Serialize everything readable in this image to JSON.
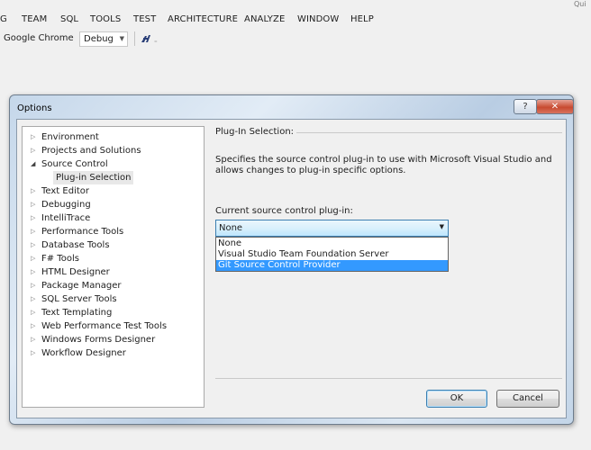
{
  "menubar": {
    "items": [
      "G",
      "TEAM",
      "SQL",
      "TOOLS",
      "TEST",
      "ARCHITECTURE",
      "ANALYZE",
      "WINDOW",
      "HELP"
    ],
    "quick_launch": "Qui"
  },
  "toolbar": {
    "browser": "Google Chrome",
    "config": "Debug"
  },
  "dialog": {
    "title": "Options",
    "help_symbol": "?",
    "close_symbol": "✕",
    "tree": [
      {
        "label": "Environment"
      },
      {
        "label": "Projects and Solutions"
      },
      {
        "label": "Source Control"
      },
      {
        "label": "Plug-in Selection"
      },
      {
        "label": "Text Editor"
      },
      {
        "label": "Debugging"
      },
      {
        "label": "IntelliTrace"
      },
      {
        "label": "Performance Tools"
      },
      {
        "label": "Database Tools"
      },
      {
        "label": "F# Tools"
      },
      {
        "label": "HTML Designer"
      },
      {
        "label": "Package Manager"
      },
      {
        "label": "SQL Server Tools"
      },
      {
        "label": "Text Templating"
      },
      {
        "label": "Web Performance Test Tools"
      },
      {
        "label": "Windows Forms Designer"
      },
      {
        "label": "Workflow Designer"
      }
    ],
    "section_title": "Plug-In Selection:",
    "description": "Specifies the source control plug-in to use with Microsoft Visual Studio and allows changes to plug-in specific options.",
    "current_label": "Current source control plug-in:",
    "selected_value": "None",
    "options": [
      "None",
      "Visual Studio Team Foundation Server",
      "Git Source Control Provider"
    ],
    "ok_label": "OK",
    "cancel_label": "Cancel"
  }
}
